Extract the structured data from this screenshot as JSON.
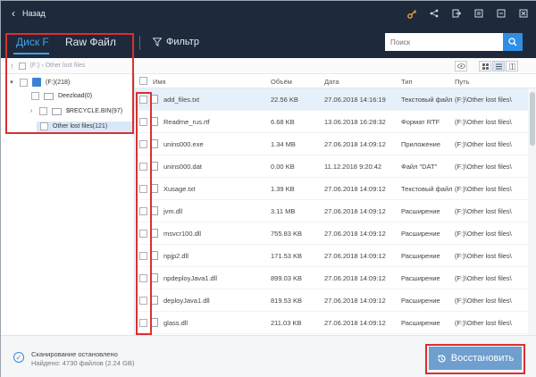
{
  "titlebar": {
    "back_label": "Назад"
  },
  "tabs": [
    {
      "label": "Диск F",
      "active": true
    },
    {
      "label": "Raw Файл",
      "active": false
    }
  ],
  "filter_label": "Фильтр",
  "search": {
    "placeholder": "Поиск"
  },
  "left_panel": {
    "path_text": "(F:)  ›  Other lost files",
    "tree": [
      {
        "label": "(F:)(218)",
        "level": 0
      },
      {
        "label": "Deezload(0)",
        "level": 1
      },
      {
        "label": "$RECYCLE.BIN(97)",
        "level": 1
      },
      {
        "label": "Other lost files(121)",
        "level": 1,
        "selected": true
      }
    ]
  },
  "table": {
    "columns": [
      "Имя",
      "Объём",
      "Дата",
      "Тип",
      "Путь"
    ],
    "rows": [
      {
        "name": "add_files.txt",
        "size": "22.56 KB",
        "date": "27.06.2018 14:16:19",
        "type": "Текстовый файл",
        "path": "(F:)\\Other lost files\\"
      },
      {
        "name": "Readme_rus.rtf",
        "size": "6.68 KB",
        "date": "13.06.2018 16:28:32",
        "type": "Формат RTF",
        "path": "(F:)\\Other lost files\\"
      },
      {
        "name": "unins000.exe",
        "size": "1.34 MB",
        "date": "27.06.2018 14:09:12",
        "type": "Приложение",
        "path": "(F:)\\Other lost files\\"
      },
      {
        "name": "unins000.dat",
        "size": "0.00 KB",
        "date": "11.12.2018 9:20:42",
        "type": "Файл \"DAT\"",
        "path": "(F:)\\Other lost files\\"
      },
      {
        "name": "Xusage.txt",
        "size": "1.39 KB",
        "date": "27.06.2018 14:09:12",
        "type": "Текстовый файл",
        "path": "(F:)\\Other lost files\\"
      },
      {
        "name": "jvm.dll",
        "size": "3.11 MB",
        "date": "27.06.2018 14:09:12",
        "type": "Расширение",
        "path": "(F:)\\Other lost files\\"
      },
      {
        "name": "msvcr100.dll",
        "size": "755.83 KB",
        "date": "27.06.2018 14:09:12",
        "type": "Расширение",
        "path": "(F:)\\Other lost files\\"
      },
      {
        "name": "npjp2.dll",
        "size": "171.53 KB",
        "date": "27.06.2018 14:09:12",
        "type": "Расширение",
        "path": "(F:)\\Other lost files\\"
      },
      {
        "name": "npdeployJava1.dll",
        "size": "899.03 KB",
        "date": "27.06.2018 14:09:12",
        "type": "Расширение",
        "path": "(F:)\\Other lost files\\"
      },
      {
        "name": "deployJava1.dll",
        "size": "819.53 KB",
        "date": "27.06.2018 14:09:12",
        "type": "Расширение",
        "path": "(F:)\\Other lost files\\"
      },
      {
        "name": "glass.dll",
        "size": "211.03 KB",
        "date": "27.06.2018 14:09:12",
        "type": "Расширение",
        "path": "(F:)\\Other lost files\\"
      }
    ]
  },
  "footer": {
    "status": "Сканирование остановлено",
    "found": "Найдено: 4730 файлов (2.24 GB)",
    "restore_label": "Восстановить"
  },
  "colors": {
    "accent": "#3fa2f0",
    "titlebar": "#1e2a3b",
    "highlight": "#d93030",
    "restore_button": "#6f9fce"
  }
}
